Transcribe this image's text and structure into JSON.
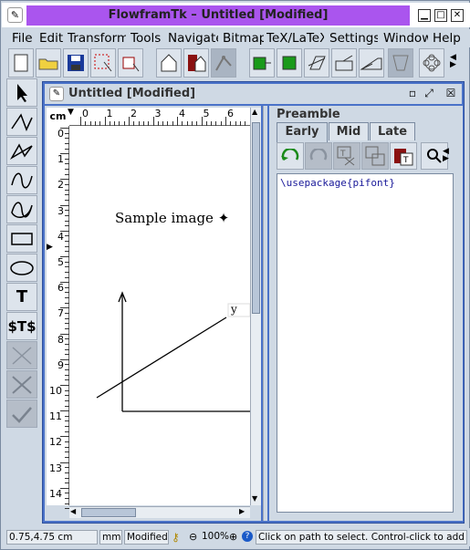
{
  "window": {
    "title": "FlowframTk – Untitled [Modified]",
    "icon": "flowframtk-icon"
  },
  "menu": [
    "File",
    "Edit",
    "Transform",
    "Tools",
    "Navigate",
    "Bitmap",
    "TeX/LaTeX",
    "Settings",
    "Window",
    "Help"
  ],
  "toolbar": {
    "icons": [
      "new-file-icon",
      "open-folder-icon",
      "save-icon",
      "select-area-icon",
      "select-with-arrow-icon",
      "house-frame-icon",
      "house-red-icon",
      "path-select-icon",
      "green-object-forward-icon",
      "green-object-back-icon",
      "skew-icon",
      "rotate-icon",
      "scale-icon",
      "shape-merge-icon",
      "pattern-icon"
    ]
  },
  "tools": [
    "select-arrow",
    "open-line",
    "closed-line",
    "open-curve",
    "closed-curve",
    "rectangle",
    "ellipse",
    "text",
    "math-text",
    "disabled-cross-1",
    "disabled-cross-2",
    "disabled-check"
  ],
  "inner": {
    "title": "Untitled [Modified]",
    "ruler_unit": "cm",
    "hruler_labels": [
      "0",
      "1",
      "2",
      "3",
      "4",
      "5",
      "6"
    ],
    "vruler_labels": [
      "0",
      "1",
      "2",
      "3",
      "4",
      "5",
      "6",
      "7",
      "8",
      "9",
      "10",
      "11",
      "12",
      "13",
      "14"
    ],
    "drawing": {
      "text": "Sample image ✦",
      "axis_label": "y"
    }
  },
  "preamble": {
    "label": "Preamble",
    "tabs": [
      "Early",
      "Mid",
      "Late"
    ],
    "active_tab": "Early",
    "editor_text_cmd": "\\usepackage",
    "editor_text_arg": "{pifont}"
  },
  "status": {
    "coords": "0.75,4.75 cm",
    "unit": "mm",
    "modified": "Modified",
    "zoom": "100%",
    "message": "Click on path to select. Control-click to add to s"
  },
  "colors": {
    "title_bar": "#aa55ee",
    "inner_frame": "#4a72c8",
    "panel": "#cfd9e4"
  }
}
